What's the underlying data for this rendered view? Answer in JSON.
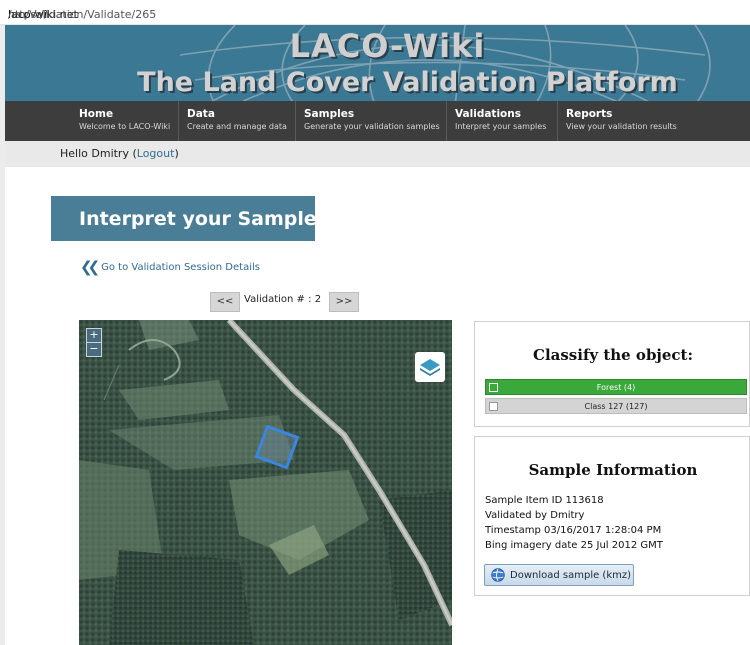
{
  "browser": {
    "url_scheme": "https://",
    "url_host": "laco-wiki.net",
    "url_path": "/en/Validation/Validate/265"
  },
  "banner": {
    "title": "LACO-Wiki",
    "subtitle": "The Land Cover Validation Platform"
  },
  "nav": {
    "items": [
      {
        "title": "Home",
        "subtitle": "Welcome to LACO-Wiki"
      },
      {
        "title": "Data",
        "subtitle": "Create and manage data"
      },
      {
        "title": "Samples",
        "subtitle": "Generate your validation samples"
      },
      {
        "title": "Validations",
        "subtitle": "Interpret your samples"
      },
      {
        "title": "Reports",
        "subtitle": "View your validation results"
      }
    ]
  },
  "user": {
    "greeting": "Hello Dmitry",
    "logout_label": "Logout"
  },
  "page": {
    "title": "Interpret your Samples",
    "back_link": "Go to Validation Session Details"
  },
  "pager": {
    "prev_label": "<<",
    "next_label": ">>",
    "label": "Validation # :",
    "number": "2"
  },
  "map": {
    "zoom_in": "+",
    "zoom_out": "−",
    "layers_icon": "layers-icon"
  },
  "classify": {
    "heading": "Classify the object:",
    "options": [
      {
        "label": "Forest (4)",
        "selected": true,
        "color": "#3aa83a"
      },
      {
        "label": "Class 127 (127)",
        "selected": false,
        "color": "#d4d4d4"
      }
    ]
  },
  "sample_info": {
    "heading": "Sample Information",
    "item_id": "Sample Item ID 113618",
    "validated_by": "Validated by Dmitry",
    "timestamp": "Timestamp 03/16/2017 1:28:04 PM",
    "imagery_date": "Bing imagery date 25 Jul 2012 GMT",
    "download_label": "Download sample (kmz)"
  },
  "colors": {
    "banner_bg": "#3b7894",
    "nav_bg": "#3d3d3d",
    "title_bg": "#4a7e96",
    "link": "#2f6e8f",
    "selected_class": "#3aa83a"
  }
}
